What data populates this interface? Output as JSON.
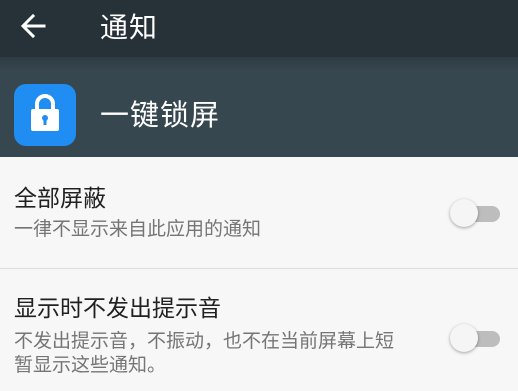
{
  "toolbar": {
    "title": "通知",
    "back_icon": "arrow-left-icon"
  },
  "app": {
    "name": "一键锁屏",
    "icon": "lock-icon",
    "icon_color": "#1f8df2"
  },
  "colors": {
    "toolbar_bg": "#273238",
    "header_bg": "#37474f",
    "page_bg": "#f7f7f7"
  },
  "settings": [
    {
      "title": "全部屏蔽",
      "summary": "一律不显示来自此应用的通知",
      "enabled": false
    },
    {
      "title": "显示时不发出提示音",
      "summary": "不发出提示音，不振动，也不在当前屏幕上短暂显示这些通知。",
      "enabled": false
    }
  ]
}
